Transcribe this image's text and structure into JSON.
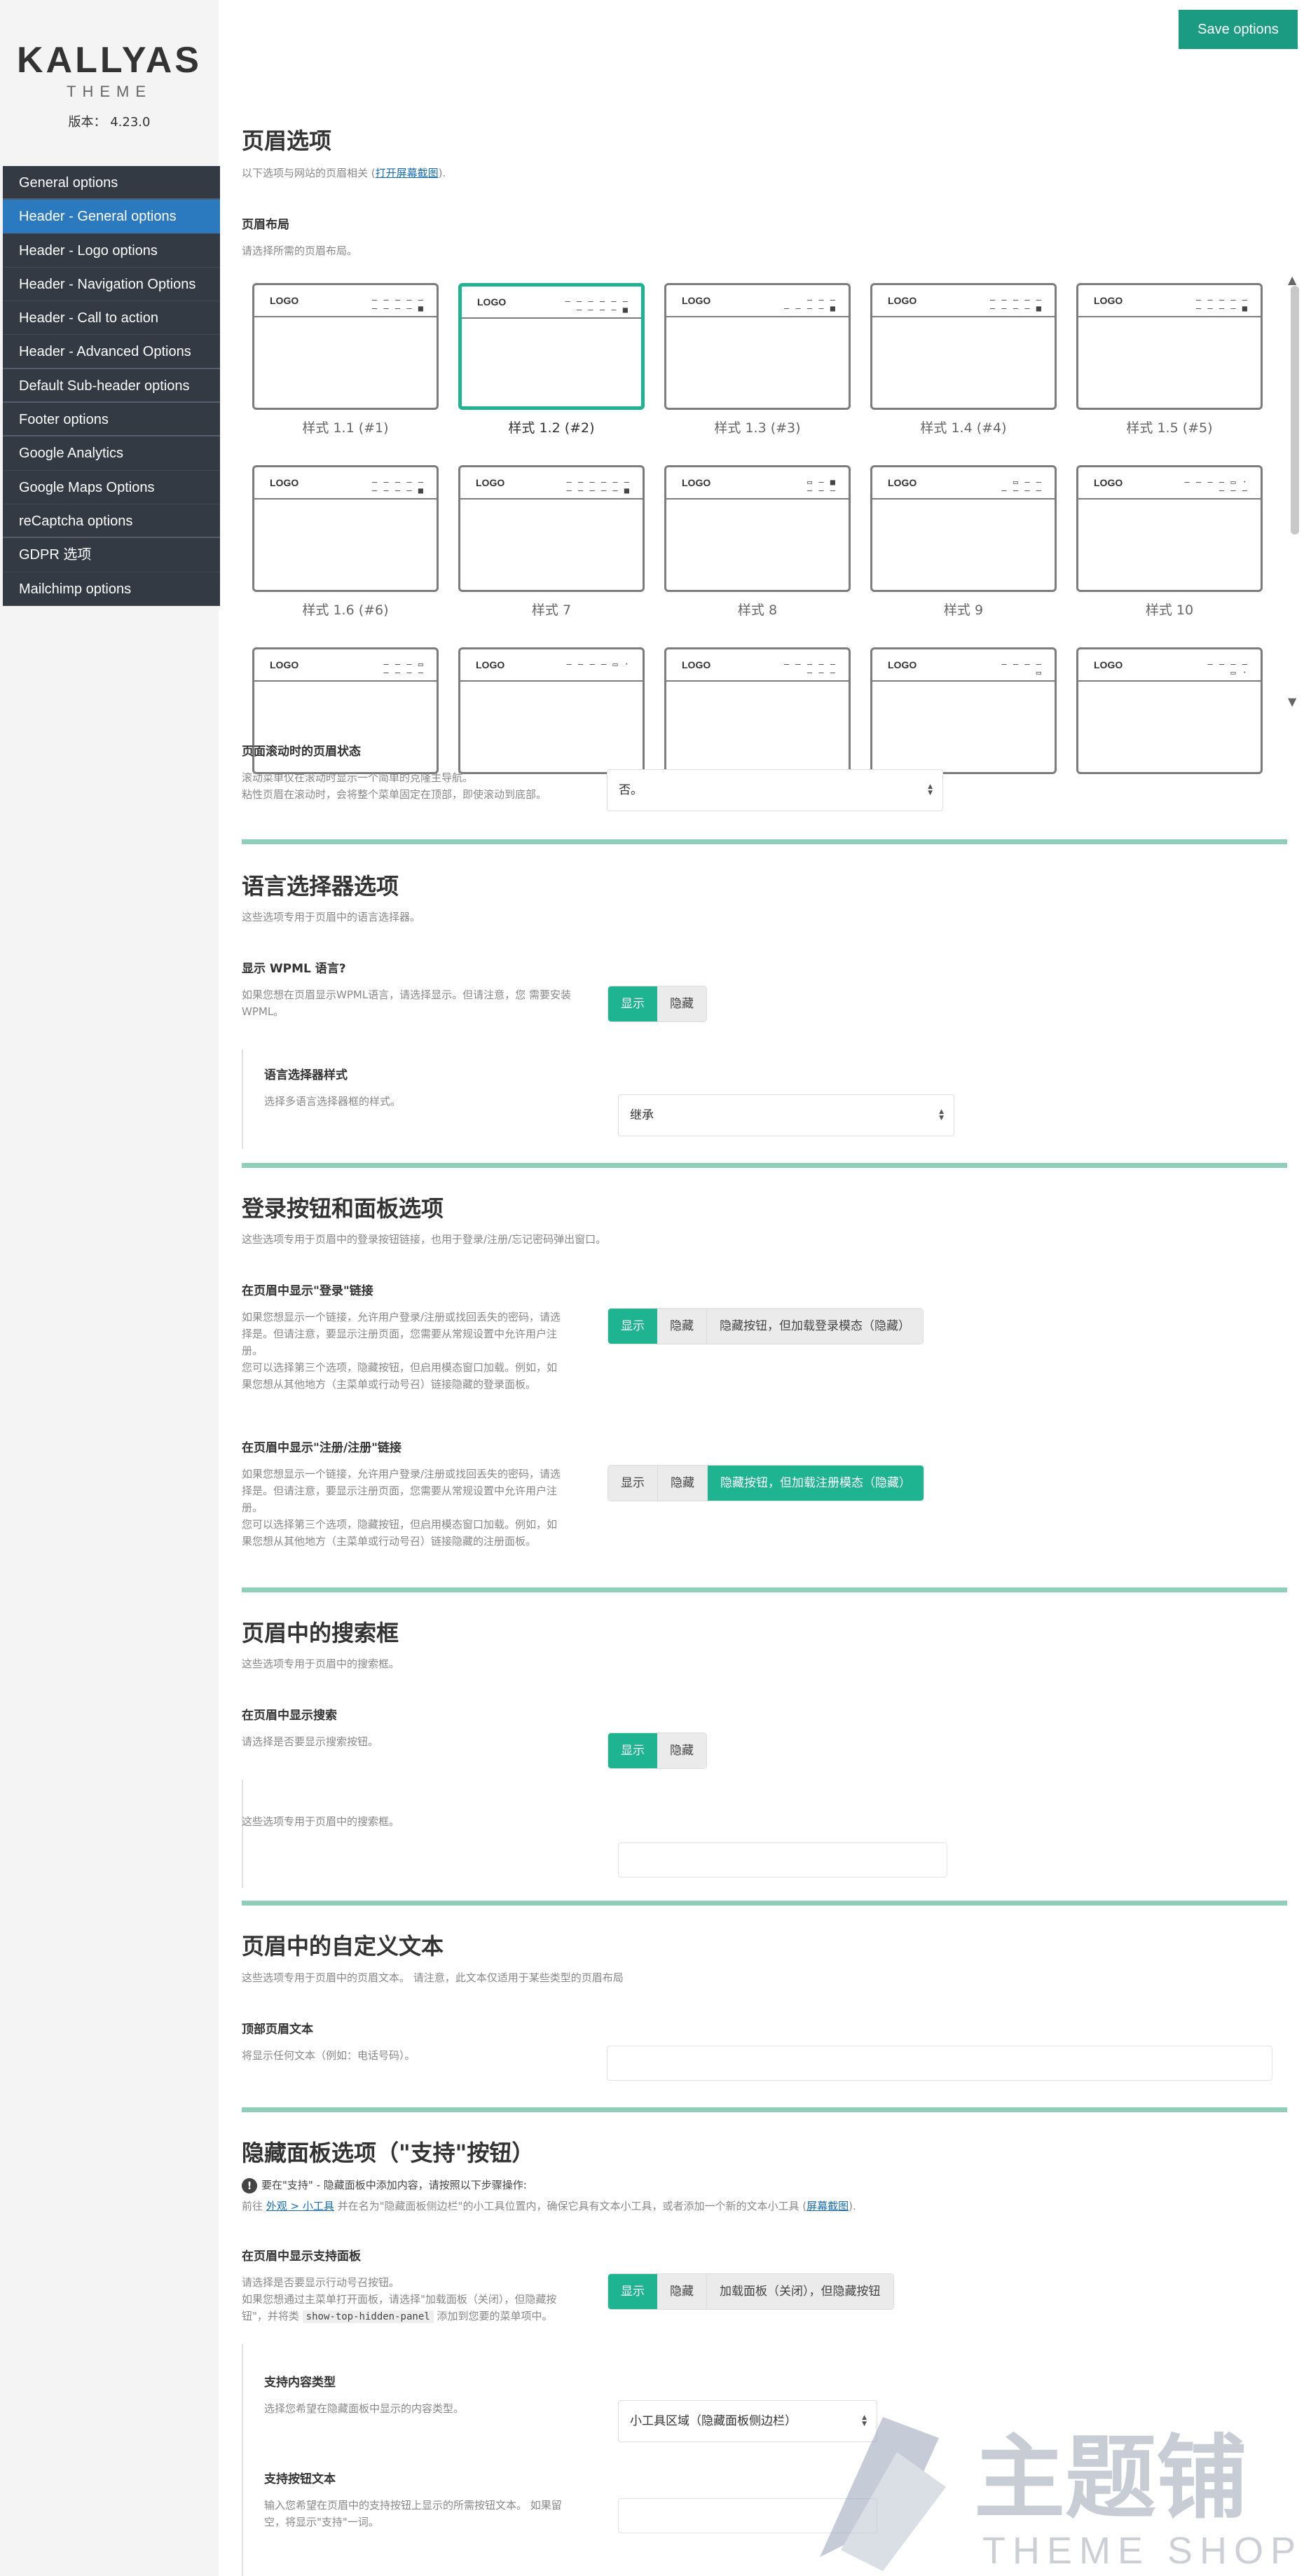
{
  "brand": {
    "title": "KALLYAS",
    "subtitle": "THEME",
    "version": "版本： 4.23.0"
  },
  "nav": [
    {
      "label": "General options"
    },
    {
      "label": "Header - General options"
    },
    {
      "label": "Header - Logo options"
    },
    {
      "label": "Header - Navigation Options"
    },
    {
      "label": "Header - Call to action"
    },
    {
      "label": "Header - Advanced Options"
    },
    {
      "label": "Default Sub-header options"
    },
    {
      "label": "Footer options"
    },
    {
      "label": "Google Analytics"
    },
    {
      "label": "Google Maps Options"
    },
    {
      "label": "reCaptcha options"
    },
    {
      "label": "GDPR 选项"
    },
    {
      "label": "Mailchimp options"
    }
  ],
  "nav_active": "Header - General options",
  "save_label": "Save options",
  "header_section": {
    "title": "页眉选项",
    "desc": "以下选项与网站的页眉相关 (",
    "desc_link": "打开屏幕截图",
    "desc_end": ").",
    "layout_title": "页眉布局",
    "layout_desc": "请选择所需的页眉布局。",
    "layouts": [
      {
        "label": "样式 1.1 (#1)",
        "logo": "LOGO",
        "l1": "— — — — —",
        "l2": "— — — — ■"
      },
      {
        "label": "样式 1.2 (#2)",
        "logo": "LOGO",
        "l1": "— —      — — — —",
        "l2": "— — — — ■"
      },
      {
        "label": "样式 1.3 (#3)",
        "logo": "LOGO",
        "l1": "— — —",
        "l2": "— — — — ■"
      },
      {
        "label": "样式 1.4 (#4)",
        "logo": "LOGO",
        "l1": "— — — — —",
        "l2": "— — — — ■"
      },
      {
        "label": "样式 1.5 (#5)",
        "logo": "LOGO",
        "l1": "— — — — —",
        "l2": "— — — — ■"
      },
      {
        "label": "样式 1.6 (#6)",
        "logo": "LOGO",
        "l1": "— — — — —",
        "l2": "— — — — ■"
      },
      {
        "label": "样式 7",
        "logo": "LOGO",
        "l1": "— — —      — — —",
        "l2": "— — — —   — ■"
      },
      {
        "label": "样式 8",
        "logo": "LOGO",
        "l1": "▭    — ■",
        "l2": "— — —"
      },
      {
        "label": "样式 9",
        "logo": "LOGO",
        "l1": "▭  — —",
        "l2": "— — — —"
      },
      {
        "label": "样式 10",
        "logo": "LOGO",
        "l1": "— — — —   ▭ ·",
        "l2": "— — —"
      },
      {
        "label": "",
        "logo": "LOGO",
        "l1": "— — —   ▭",
        "l2": "— — — —"
      },
      {
        "label": "",
        "logo": "LOGO",
        "l1": "— — — —   ▭ ·",
        "l2": ""
      },
      {
        "label": "",
        "logo": "LOGO",
        "l1": "— — —   — —",
        "l2": "— — —"
      },
      {
        "label": "",
        "logo": "LOGO",
        "l1": "— — — —",
        "l2": "▭"
      },
      {
        "label": "",
        "logo": "LOGO",
        "l1": "— — — —",
        "l2": "▭ ·"
      }
    ],
    "selected_layout": "样式 1.2 (#2)",
    "sticky_title": "页面滚动时的页眉状态",
    "sticky_desc_1": "滚动菜单仅在滚动时显示一个简单的克隆主导航。",
    "sticky_desc_2": "粘性页眉在滚动时，会将整个菜单固定在顶部，即使滚动到底部。",
    "sticky_value": "否。"
  },
  "language_section": {
    "title": "语言选择器选项",
    "desc": "这些选项专用于页眉中的语言选择器。",
    "wpml_title": "显示 WPML 语言?",
    "wpml_desc_1": "如果您想在页眉显示WPML语言，请选择显示。但请注意，您 需要安装",
    "wpml_desc_2": "WPML。",
    "opt_show": "显示",
    "opt_hide": "隐藏",
    "style_title": "语言选择器样式",
    "style_desc": "选择多语言选择器框的样式。",
    "style_value": "继承"
  },
  "login_section": {
    "title": "登录按钮和面板选项",
    "desc": "这些选项专用于页眉中的登录按钮链接，也用于登录/注册/忘记密码弹出窗口。",
    "login_title": "在页眉中显示\"登录\"链接",
    "login_desc": [
      "如果您想显示一个链接，允许用户登录/注册或找回丢失的密码，请选",
      "择是。但请注意，要显示注册页面，您需要从常规设置中允许用户注",
      "册。",
      "您可以选择第三个选项，隐藏按钮，但启用模态窗口加载。例如，如",
      "果您想从其他地方（主菜单或行动号召）链接隐藏的登录面板。"
    ],
    "login_opt_3": "隐藏按钮，但加载登录模态（隐藏）",
    "register_title": "在页眉中显示\"注册/注册\"链接",
    "register_desc": [
      "如果您想显示一个链接，允许用户登录/注册或找回丢失的密码，请选",
      "择是。但请注意，要显示注册页面，您需要从常规设置中允许用户注",
      "册。",
      "您可以选择第三个选项，隐藏按钮，但启用模态窗口加载。例如，如",
      "果您想从其他地方（主菜单或行动号召）链接隐藏的注册面板。"
    ],
    "register_opt_3": "隐藏按钮，但加载注册模态（隐藏）"
  },
  "search_section": {
    "title": "页眉中的搜索框",
    "desc": "这些选项专用于页眉中的搜索框。",
    "show_title": "在页眉中显示搜索",
    "show_desc": "请选择是否要显示搜索按钮。",
    "sub_desc": "这些选项专用于页眉中的搜索框。"
  },
  "text_section": {
    "title": "页眉中的自定义文本",
    "desc": "这些选项专用于页眉中的页眉文本。 请注意，此文本仅适用于某些类型的页眉布局",
    "top_title": "顶部页眉文本",
    "top_desc": "将显示任何文本（例如：电话号码）。"
  },
  "hidden_section": {
    "title": "隐藏面板选项（\"支持\"按钮）",
    "info_icon": "info-icon",
    "info_text": "要在\"支持\" - 隐藏面板中添加内容，请按照以下步骤操作:",
    "info_line_1": "前往 ",
    "info_link_1": "外观 > 小工具",
    "info_line_2": " 并在名为\"隐藏面板侧边栏\"的小工具位置内，确保它具有文本小工具，或者添加一个新的文本小工具 (",
    "info_link_2": "屏幕截图",
    "info_line_3": ").",
    "panel_title": "在页眉中显示支持面板",
    "panel_desc_1": "请选择是否要显示行动号召按钮。",
    "panel_desc_2": "如果您想通过主菜单打开面板，请选择\"加载面板（关闭），但隐藏按",
    "panel_desc_3a": "钮\"，并将类 ",
    "panel_desc_code": "show-top-hidden-panel",
    "panel_desc_3b": " 添加到您要的菜单项中。",
    "panel_opt_3": "加载面板（关闭），但隐藏按钮",
    "content_title": "支持内容类型",
    "content_desc": "选择您希望在隐藏面板中显示的内容类型。",
    "content_value": "小工具区域（隐藏面板侧边栏）",
    "btn_title": "支持按钮文本",
    "btn_desc_1": "输入您希望在页眉中的支持按钮上显示的所需按钮文本。 如果留",
    "btn_desc_2": "空，将显示\"支持\"一词。"
  },
  "watermark": {
    "main": "主题铺",
    "sub": "THEME SHOP"
  }
}
